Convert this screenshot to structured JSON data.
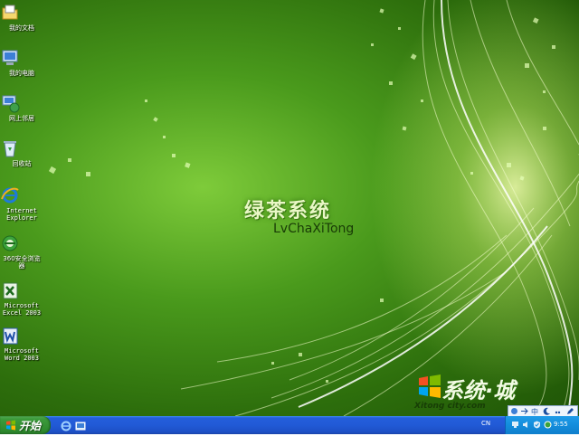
{
  "desktop": {
    "icons": [
      {
        "label": "我的文档",
        "icon": "my-documents-icon"
      },
      {
        "label": "我的电脑",
        "icon": "my-computer-icon"
      },
      {
        "label": "网上邻居",
        "icon": "network-places-icon"
      },
      {
        "label": "回收站",
        "icon": "recycle-bin-icon"
      },
      {
        "label": "Internet\nExplorer",
        "icon": "internet-explorer-icon"
      },
      {
        "label": "360安全浏览\n器",
        "icon": "360-browser-icon"
      },
      {
        "label": "Microsoft\nExcel 2003",
        "icon": "excel-icon"
      },
      {
        "label": "Microsoft\nWord 2003",
        "icon": "word-icon"
      }
    ]
  },
  "wallpaper": {
    "brand_cn": "绿茶系统",
    "brand_en": "LvChaXiTong"
  },
  "watermark": {
    "cn": "系统·城",
    "url": "Xitong city.com"
  },
  "taskbar": {
    "start_label": "开始",
    "language": "CN",
    "clock": "9:55"
  },
  "ime_bar": {
    "mode": "中"
  },
  "colors": {
    "wallpaper_green": "#4a9a1c",
    "taskbar_blue": "#245edb",
    "start_green": "#3c9b3c",
    "tray_blue": "#138ddc"
  }
}
